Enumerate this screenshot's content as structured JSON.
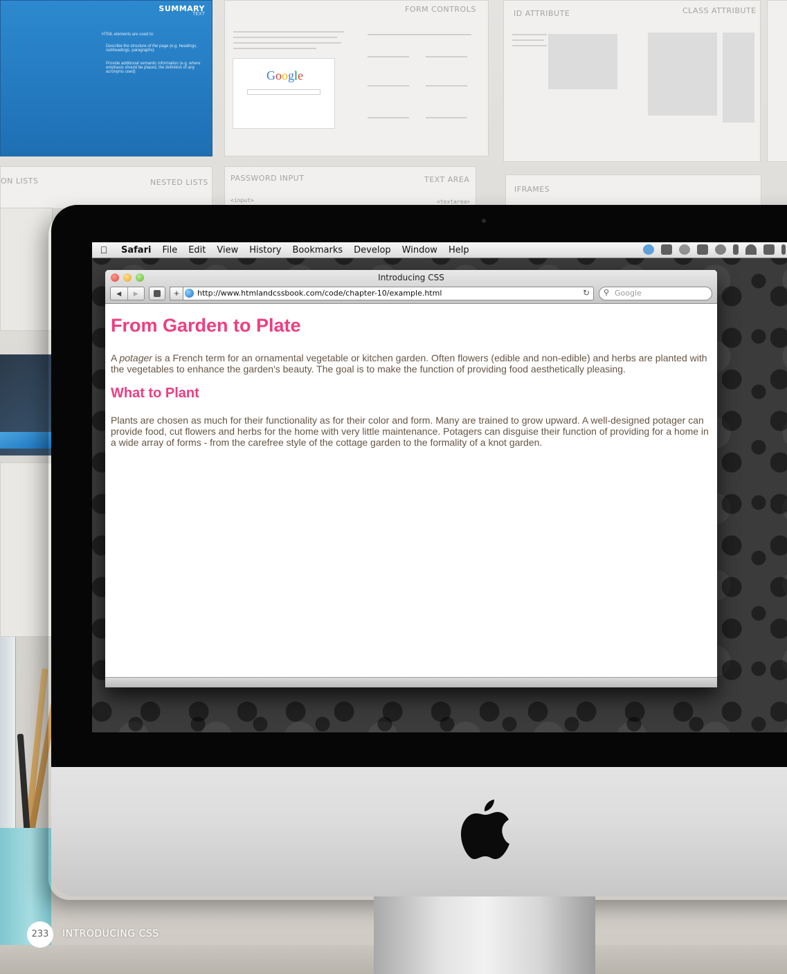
{
  "wall": {
    "posters": [
      {
        "title": "SUMMARY",
        "subtitle": "TEXT"
      },
      {
        "title": "FORM CONTROLS"
      },
      {
        "title": "ID ATTRIBUTE"
      },
      {
        "title": "CLASS ATTRIBUTE"
      },
      {
        "title": "NESTED LISTS"
      },
      {
        "title": "PASSWORD INPUT"
      },
      {
        "title": "TEXT AREA"
      },
      {
        "title": "IFRAMES"
      }
    ],
    "left_fragment": "ON LISTS",
    "tags": {
      "input": "<input>",
      "textarea": "<textarea>"
    },
    "summary_bullets": [
      "HTML elements are used to:",
      "Describe the structure of the page (e.g. headings, subheadings, paragraphs)",
      "Provide additional semantic information (e.g. where emphasis should be placed, the definition of any acronyms used)"
    ],
    "google_logo": [
      "G",
      "o",
      "o",
      "g",
      "l",
      "e"
    ]
  },
  "menubar": {
    "app_name": "Safari",
    "items": [
      "File",
      "Edit",
      "View",
      "History",
      "Bookmarks",
      "Develop",
      "Window",
      "Help"
    ]
  },
  "browser": {
    "window_title": "Introducing CSS",
    "url": "http://www.htmlandcssbook.com/code/chapter-10/example.html",
    "search_placeholder": "Google",
    "nav_back": "◀",
    "nav_forward": "▶",
    "add_label": "+",
    "reload_label": "↻"
  },
  "page": {
    "h1": "From Garden to Plate",
    "p1_lead": "A ",
    "p1_em": "potager",
    "p1_rest": " is a French term for an ornamental vegetable or kitchen garden. Often flowers (edible and non-edible) and herbs are planted with the vegetables to enhance the garden's beauty. The goal is to make the function of providing food aesthetically pleasing.",
    "h2": "What to Plant",
    "p2": "Plants are chosen as much for their functionality as for their color and form. Many are trained to grow upward. A well-designed potager can provide food, cut flowers and herbs for the home with very little maintenance. Potagers can disguise their function of providing for a home in a wide array of forms - from the carefree style of the cottage garden to the formality of a knot garden."
  },
  "colors": {
    "heading": "#ee3e80",
    "body_text": "#665544",
    "summary_panel": "#2d89cf"
  },
  "footer": {
    "page_number": "233",
    "section": "INTRODUCING CSS"
  }
}
